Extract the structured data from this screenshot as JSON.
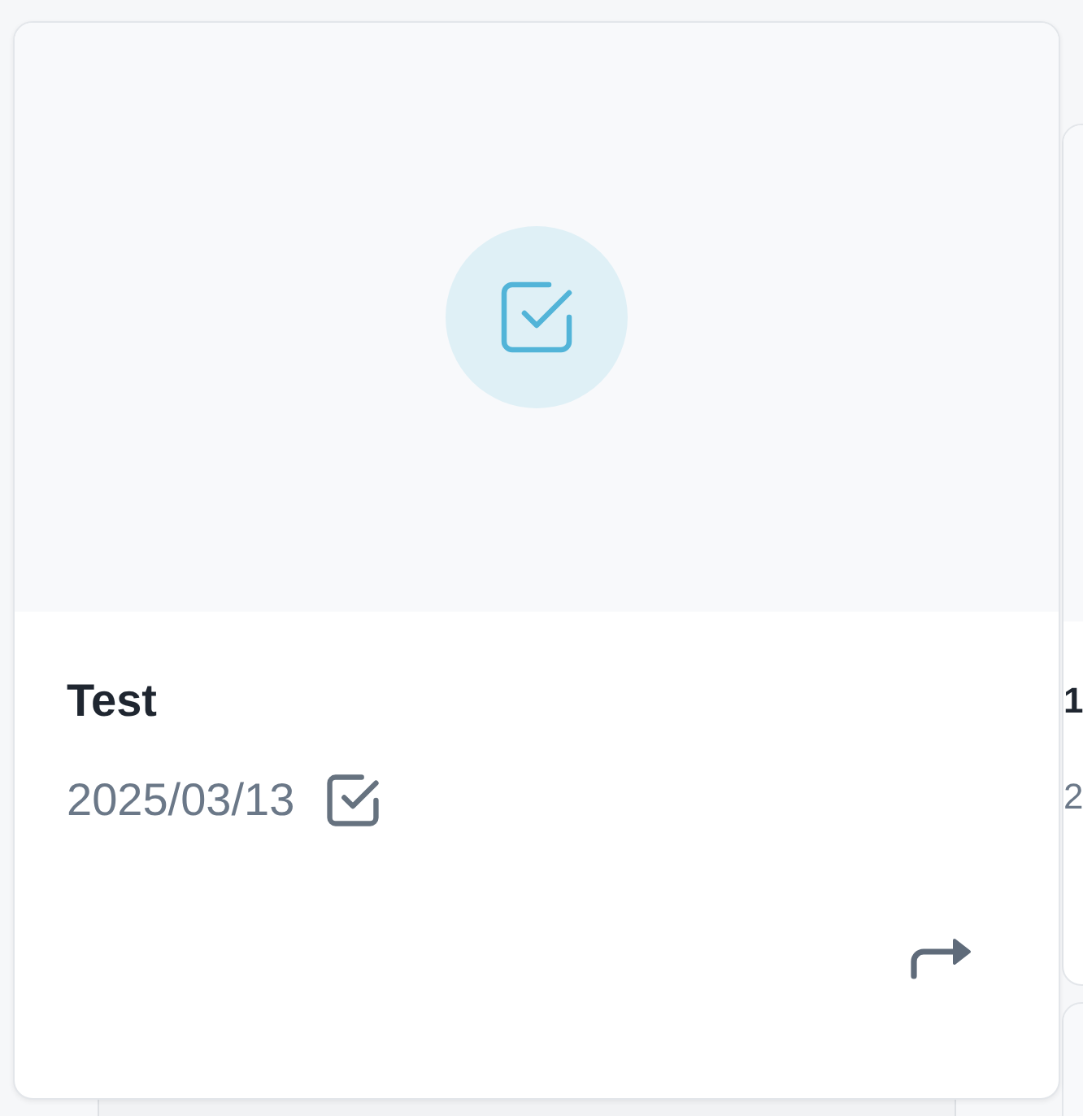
{
  "cards": [
    {
      "title": "Test",
      "date": "2025/03/13"
    }
  ],
  "peek_cards": [
    {
      "title": "1",
      "date": "2"
    }
  ]
}
